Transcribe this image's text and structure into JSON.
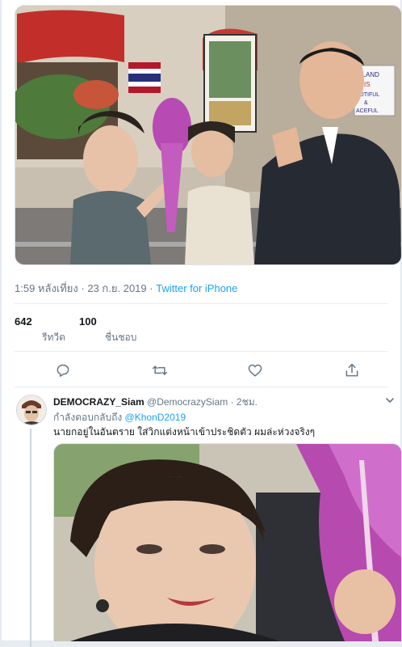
{
  "tweet": {
    "time": "1:59 หลังเที่ยง · 23 ก.ย. 2019",
    "source": "Twitter for iPhone",
    "retweets": {
      "count": "642",
      "label": "รีทวีต"
    },
    "likes": {
      "count": "100",
      "label": "ชื่นชอบ"
    },
    "sign_text": "THAILAND IS BEAUTIFUL & PEACEFUL"
  },
  "reply": {
    "name": "DEMOCRAZY_Siam",
    "handle": "@DemocrazySiam",
    "time": "· 2ชม.",
    "replying_prefix": "กำลังตอบกลับถึง",
    "replying_to": "@KhonD2019",
    "text": "นายกอยู่ในอันตราย  ใส่วิกแต่งหน้าเข้าประชิดตัว ผมล่ะห่วงจริงๆ"
  },
  "icons": [
    "reply-icon",
    "retweet-icon",
    "like-icon",
    "share-icon",
    "chevron-down-icon"
  ],
  "colors": {
    "link": "#1da1f2",
    "muted": "#657786",
    "text": "#14171a",
    "divider": "#e6ecf0"
  }
}
